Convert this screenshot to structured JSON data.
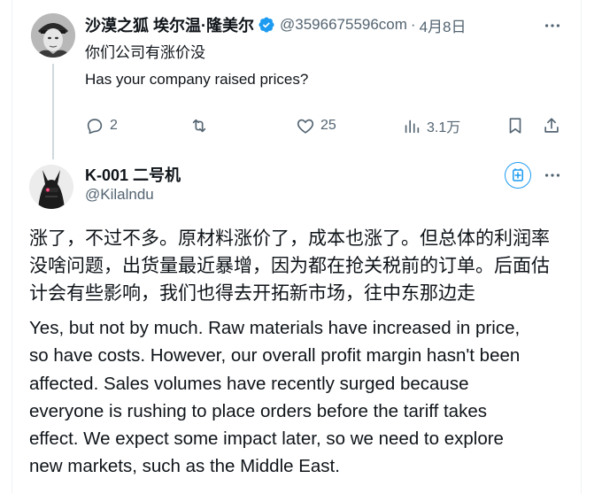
{
  "original_tweet": {
    "display_name": "沙漠之狐 埃尔温·隆美尔",
    "handle": "@3596675596com",
    "separator": "·",
    "date": "4月8日",
    "text_cn": "你们公司有涨价没",
    "text_en": "Has your company raised prices?",
    "actions": {
      "replies": "2",
      "retweets": "",
      "likes": "25",
      "views": "3.1万"
    }
  },
  "reply_tweet": {
    "display_name": "K-001 二号机",
    "handle": "@Kilalndu",
    "text_cn_lines": [
      "涨了，不过不多。原材料涨价了，成本也涨了。但总体的利润率",
      "没啥问题，出货量最近暴增，因为都在抢关税前的订单。后面估",
      "计会有些影响，我们也得去开拓新市场，往中东那边走"
    ],
    "text_en_lines": [
      "Yes, but not by much. Raw materials have increased in price,",
      "so have costs. However, our overall profit margin hasn't been",
      "affected. Sales volumes have recently surged because",
      "everyone is rushing to place orders before the tariff takes",
      "effect. We expect some impact later, so we need to explore",
      "new markets, such as the Middle East."
    ]
  },
  "colors": {
    "accent": "#1d9bf0",
    "text_primary": "#0f1419",
    "text_secondary": "#536471",
    "thread_line": "#cfd9de"
  },
  "icons": [
    "verified-badge-icon",
    "more-icon",
    "reply-icon",
    "retweet-icon",
    "like-icon",
    "views-icon",
    "bookmark-icon",
    "share-icon",
    "subscribe-icon"
  ]
}
